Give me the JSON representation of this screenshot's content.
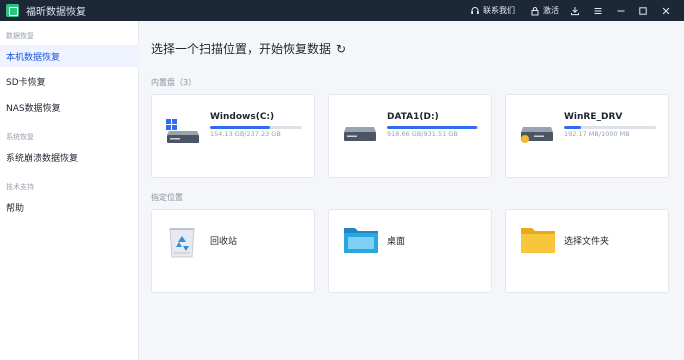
{
  "app": {
    "title": "福昕数据恢复"
  },
  "titlebar": {
    "contact_label": "联系我们",
    "activate_label": "激活"
  },
  "sidebar": {
    "sections": [
      {
        "title": "数据恢复",
        "items": [
          {
            "label": "本机数据恢复",
            "active": true
          },
          {
            "label": "SD卡恢复"
          },
          {
            "label": "NAS数据恢复"
          }
        ]
      },
      {
        "title": "系统恢复",
        "items": [
          {
            "label": "系统崩溃数据恢复"
          }
        ]
      },
      {
        "title": "技术支持",
        "items": [
          {
            "label": "帮助"
          }
        ]
      }
    ]
  },
  "main": {
    "title": "选择一个扫描位置，开始恢复数据",
    "drives_section": "内置盘（3）",
    "drives": [
      {
        "name": "Windows(C:)",
        "size": "154.13 GB/237.23 GB",
        "used_fraction": 0.65
      },
      {
        "name": "DATA1(D:)",
        "size": "918.66 GB/931.51 GB",
        "used_fraction": 0.98
      },
      {
        "name": "WinRE_DRV",
        "size": "192.17 MB/1000 MB",
        "used_fraction": 0.19
      }
    ],
    "places_section": "指定位置",
    "places": [
      {
        "label": "回收站",
        "icon": "recycle-bin-icon"
      },
      {
        "label": "桌面",
        "icon": "desktop-folder-icon"
      },
      {
        "label": "选择文件夹",
        "icon": "folder-icon"
      }
    ]
  },
  "colors": {
    "accent": "#2f6bf0",
    "titlebar": "#1c2737",
    "folder": "#f7c63b"
  }
}
